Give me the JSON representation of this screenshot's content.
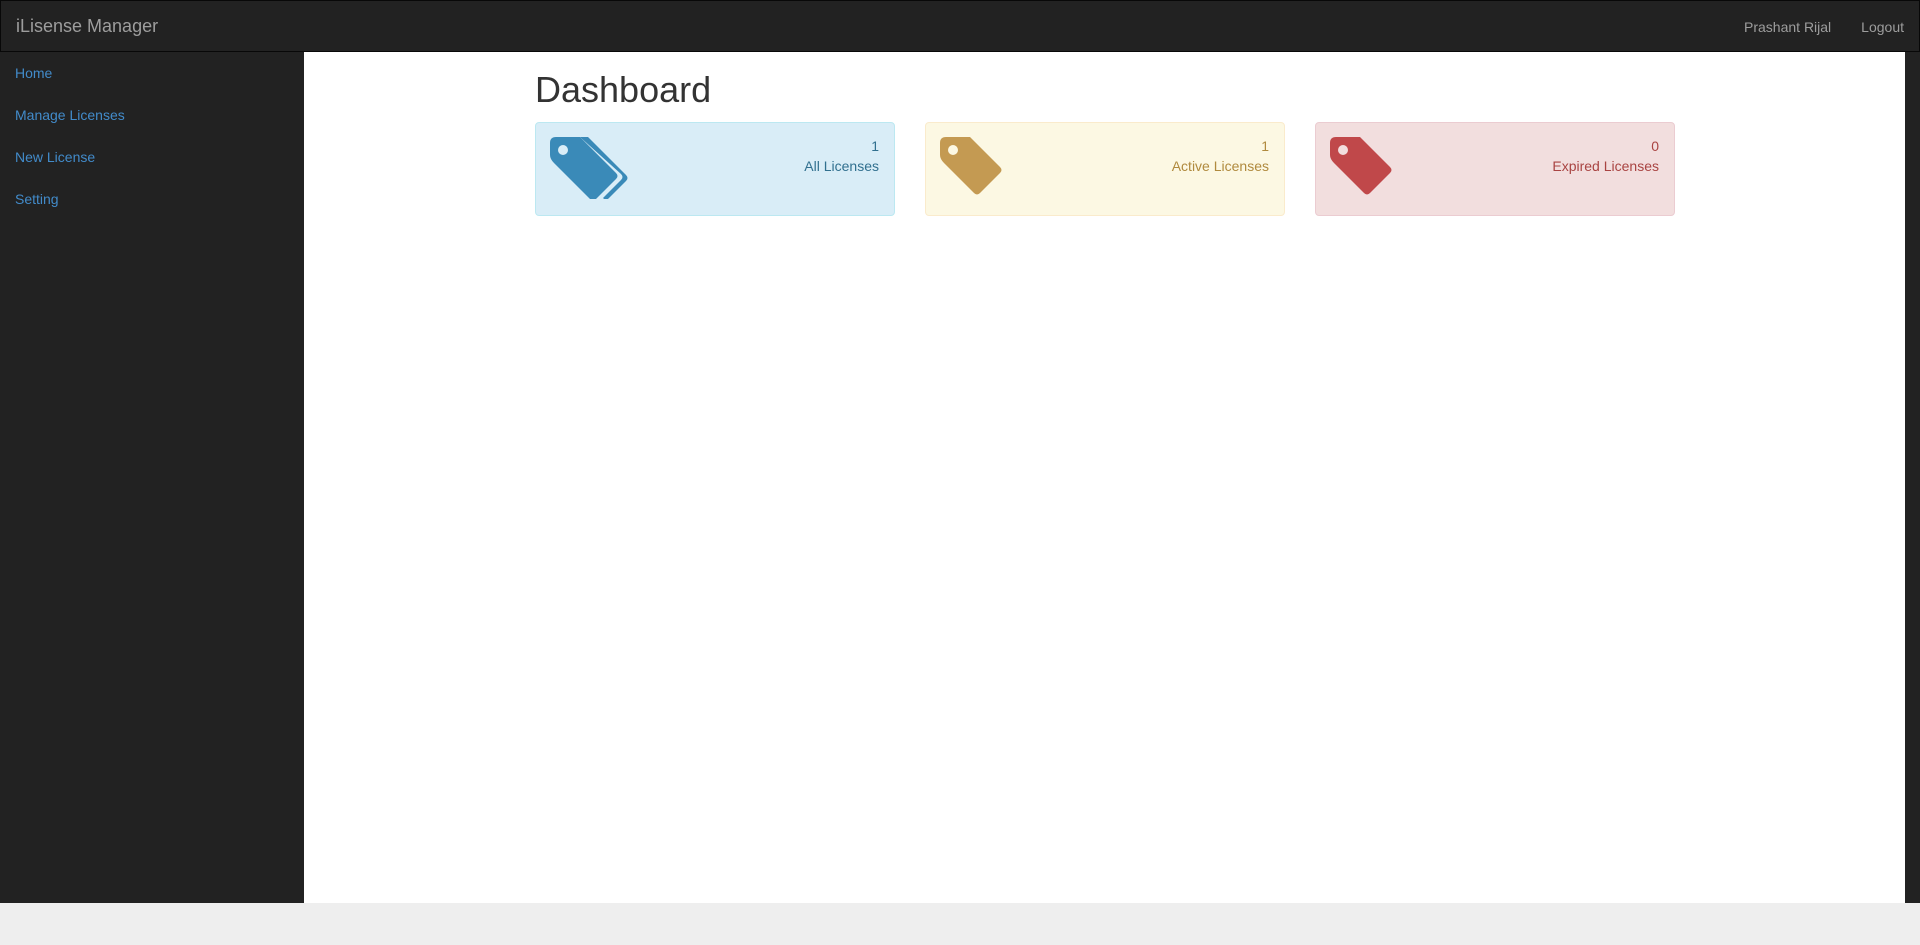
{
  "navbar": {
    "brand": "iLisense Manager",
    "user_name": "Prashant Rijal",
    "logout_label": "Logout"
  },
  "sidebar": {
    "items": [
      {
        "label": "Home"
      },
      {
        "label": "Manage Licenses"
      },
      {
        "label": "New License"
      },
      {
        "label": "Setting"
      }
    ]
  },
  "main": {
    "title": "Dashboard",
    "panels": [
      {
        "count": "1",
        "label": "All Licenses",
        "icon": "tags-icon",
        "color": "#3a8ab8"
      },
      {
        "count": "1",
        "label": "Active Licenses",
        "icon": "tag-icon",
        "color": "#c49a52"
      },
      {
        "count": "0",
        "label": "Expired Licenses",
        "icon": "tag-icon",
        "color": "#c0484a"
      }
    ]
  },
  "colors": {
    "navbar_bg": "#222222",
    "link": "#428bca",
    "info_bg": "#d9edf7",
    "warning_bg": "#fcf8e3",
    "danger_bg": "#f2dede"
  }
}
